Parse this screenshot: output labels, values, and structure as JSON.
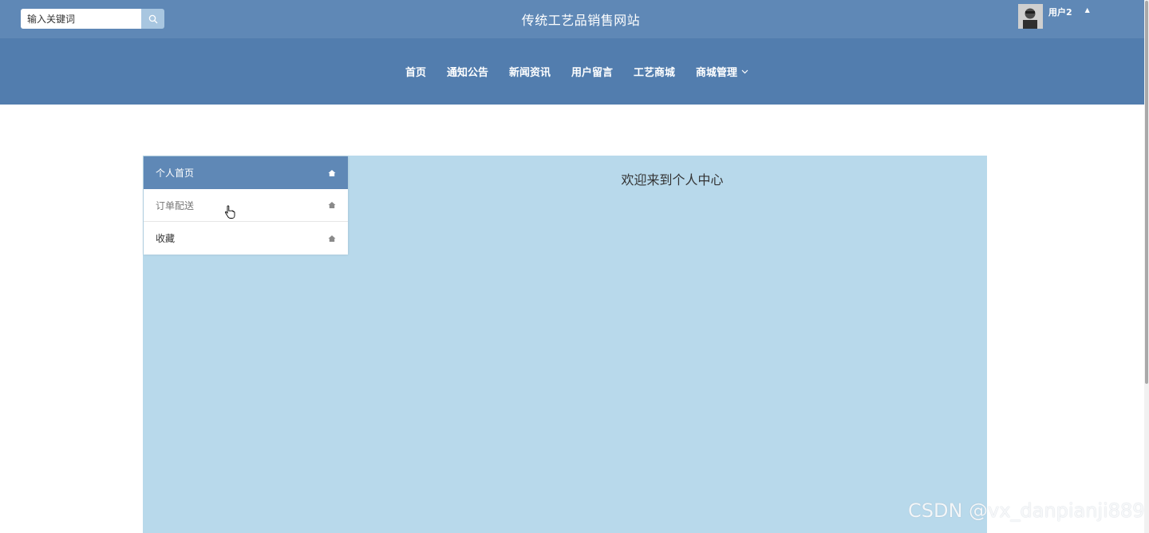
{
  "header": {
    "search_placeholder": "输入关键词",
    "site_title": "传统工艺品销售网站",
    "user_name": "用户2"
  },
  "nav": {
    "items": [
      {
        "label": "首页"
      },
      {
        "label": "通知公告"
      },
      {
        "label": "新闻资讯"
      },
      {
        "label": "用户留言"
      },
      {
        "label": "工艺商城"
      },
      {
        "label": "商城管理",
        "has_dropdown": true
      }
    ]
  },
  "sidebar": {
    "items": [
      {
        "label": "个人首页",
        "active": true
      },
      {
        "label": "订单配送"
      },
      {
        "label": "收藏"
      }
    ]
  },
  "main": {
    "welcome": "欢迎来到个人中心"
  },
  "watermark": "CSDN @vx_danpianji889",
  "colors": {
    "topbar": "#5f88b6",
    "navbar": "#527dae",
    "panel": "#b8d9eb",
    "active_item": "#5f88b6"
  }
}
